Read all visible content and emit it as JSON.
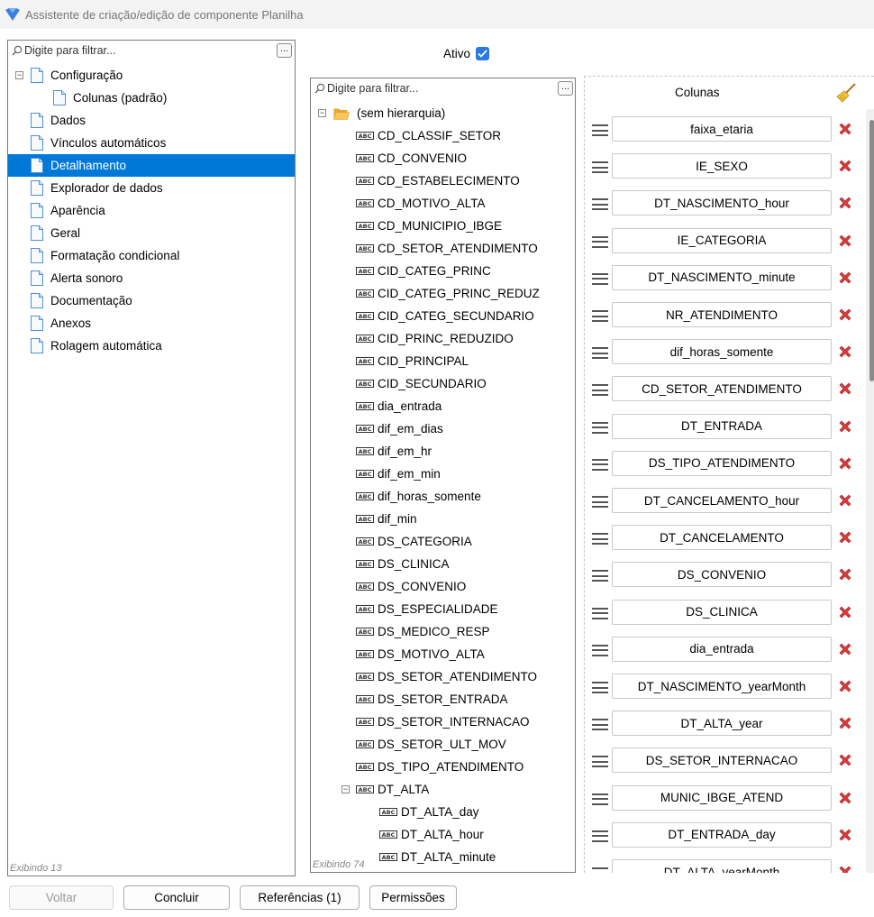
{
  "window": {
    "title": "Assistente de criação/edição de componente Planilha"
  },
  "left_panel": {
    "filter_placeholder": "Digite para filtrar...",
    "menu_label": "...",
    "status": "Exibindo 13",
    "items": [
      {
        "label": "Configuração",
        "expander": "−"
      },
      {
        "label": "Colunas (padrão)"
      },
      {
        "label": "Dados"
      },
      {
        "label": "Vínculos automáticos"
      },
      {
        "label": "Detalhamento",
        "selected": true
      },
      {
        "label": "Explorador de dados"
      },
      {
        "label": "Aparência"
      },
      {
        "label": "Geral"
      },
      {
        "label": "Formatação condicional"
      },
      {
        "label": "Alerta sonoro"
      },
      {
        "label": "Documentação"
      },
      {
        "label": "Anexos"
      },
      {
        "label": "Rolagem automática"
      }
    ]
  },
  "ativo": {
    "label": "Ativo",
    "checked": true
  },
  "fields_panel": {
    "filter_placeholder": "Digite para filtrar...",
    "menu_label": "...",
    "status": "Exibindo 74",
    "root": {
      "label": "(sem hierarquia)",
      "expander": "−"
    },
    "fields": [
      "CD_CLASSIF_SETOR",
      "CD_CONVENIO",
      "CD_ESTABELECIMENTO",
      "CD_MOTIVO_ALTA",
      "CD_MUNICIPIO_IBGE",
      "CD_SETOR_ATENDIMENTO",
      "CID_CATEG_PRINC",
      "CID_CATEG_PRINC_REDUZ",
      "CID_CATEG_SECUNDARIO",
      "CID_PRINC_REDUZIDO",
      "CID_PRINCIPAL",
      "CID_SECUNDARIO",
      "dia_entrada",
      "dif_em_dias",
      "dif_em_hr",
      "dif_em_min",
      "dif_horas_somente",
      "dif_min",
      "DS_CATEGORIA",
      "DS_CLINICA",
      "DS_CONVENIO",
      "DS_ESPECIALIDADE",
      "DS_MEDICO_RESP",
      "DS_MOTIVO_ALTA",
      "DS_SETOR_ATENDIMENTO",
      "DS_SETOR_ENTRADA",
      "DS_SETOR_INTERNACAO",
      "DS_SETOR_ULT_MOV",
      "DS_TIPO_ATENDIMENTO"
    ],
    "expanded_field": {
      "label": "DT_ALTA",
      "expander": "−"
    },
    "sub_fields": [
      "DT_ALTA_day",
      "DT_ALTA_hour",
      "DT_ALTA_minute"
    ]
  },
  "columns_panel": {
    "header": "Colunas",
    "clear_icon": "broom-icon",
    "columns": [
      "faixa_etaria",
      "IE_SEXO",
      "DT_NASCIMENTO_hour",
      "IE_CATEGORIA",
      "DT_NASCIMENTO_minute",
      "NR_ATENDIMENTO",
      "dif_horas_somente",
      "CD_SETOR_ATENDIMENTO",
      "DT_ENTRADA",
      "DS_TIPO_ATENDIMENTO",
      "DT_CANCELAMENTO_hour",
      "DT_CANCELAMENTO",
      "DS_CONVENIO",
      "DS_CLINICA",
      "dia_entrada",
      "DT_NASCIMENTO_yearMonth",
      "DT_ALTA_year",
      "DS_SETOR_INTERNACAO",
      "MUNIC_IBGE_ATEND",
      "DT_ENTRADA_day",
      "DT_ALTA_yearMonth"
    ]
  },
  "footer": {
    "back": "Voltar",
    "finish": "Concluir",
    "references": "Referências (1)",
    "permissions": "Permissões"
  },
  "colors": {
    "selection": "#0078d7",
    "checkbox": "#2a7ae2",
    "delete": "#d83b3b",
    "folder": "#f5b63b"
  }
}
